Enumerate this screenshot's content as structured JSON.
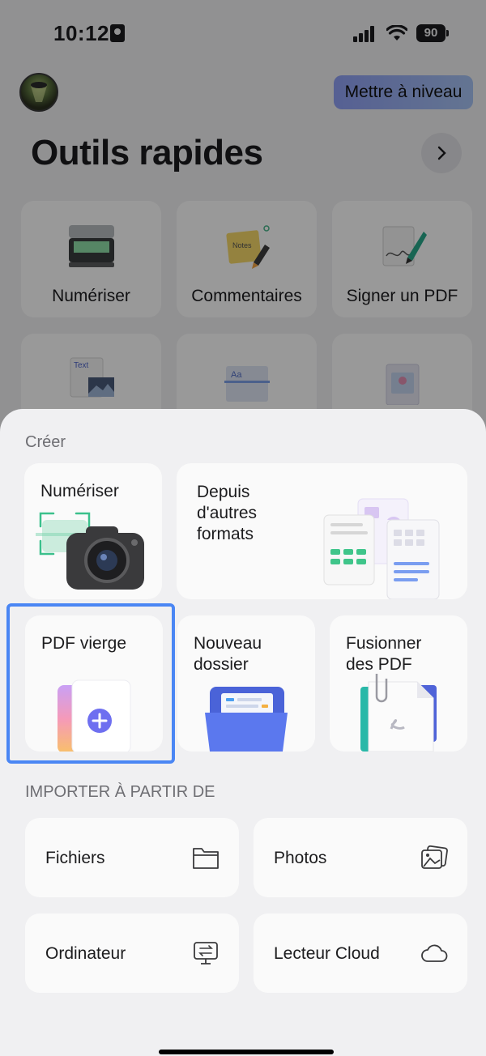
{
  "status_bar": {
    "time": "10:12",
    "battery": "90"
  },
  "header": {
    "upgrade_label": "Mettre à niveau"
  },
  "quick_tools": {
    "title": "Outils rapides",
    "tiles": [
      {
        "label": "Numériser",
        "icon": "scanner-icon"
      },
      {
        "label": "Commentaires",
        "icon": "sticky-note-icon"
      },
      {
        "label": "Signer un PDF",
        "icon": "signature-pen-icon"
      },
      {
        "label": "",
        "icon": "text-image-icon"
      },
      {
        "label": "",
        "icon": "ocr-icon"
      },
      {
        "label": "",
        "icon": "image-document-icon"
      }
    ]
  },
  "sheet": {
    "create_title": "Créer",
    "create_items": [
      {
        "label": "Numériser",
        "icon": "camera-icon"
      },
      {
        "label": "Depuis\nd'autres\nformats",
        "icon": "documents-icon"
      },
      {
        "label": "PDF vierge",
        "icon": "blank-pdf-add-icon"
      },
      {
        "label": "Nouveau\ndossier",
        "icon": "folder-icon"
      },
      {
        "label": "Fusionner\ndes PDF",
        "icon": "merge-pdf-icon"
      }
    ],
    "import_title": "IMPORTER À PARTIR DE",
    "import_items": [
      {
        "label": "Fichiers",
        "icon": "folder-outline-icon"
      },
      {
        "label": "Photos",
        "icon": "photos-icon"
      },
      {
        "label": "Ordinateur",
        "icon": "computer-transfer-icon"
      },
      {
        "label": "Lecteur Cloud",
        "icon": "cloud-icon"
      }
    ]
  }
}
